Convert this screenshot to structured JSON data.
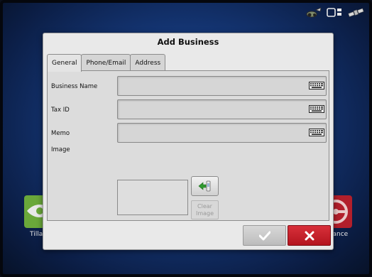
{
  "dialog": {
    "title": "Add Business",
    "tabs": [
      {
        "label": "General",
        "active": true
      },
      {
        "label": "Phone/Email",
        "active": false
      },
      {
        "label": "Address",
        "active": false
      }
    ],
    "fields": {
      "business_name": {
        "label": "Business Name",
        "value": ""
      },
      "tax_id": {
        "label": "Tax ID",
        "value": ""
      },
      "memo": {
        "label": "Memo",
        "value": ""
      },
      "image": {
        "label": "Image"
      }
    },
    "clear_image_label_line1": "Clear",
    "clear_image_label_line2": "Image",
    "ok_icon": "checkmark-icon",
    "cancel_icon": "close-x-icon"
  },
  "background": {
    "left_tile_label": "Tilla",
    "right_tile_label": "lance",
    "left_tile_icon": "tillage-icon",
    "right_tile_icon": "steering-wheel-icon"
  },
  "status": {
    "icons": [
      "gps-tractor-icon",
      "display-window-icon",
      "satellite-icon"
    ]
  },
  "colors": {
    "background_blue": "#143573",
    "cancel_red": "#c4222c",
    "dialog_gray": "#e9e9e9"
  }
}
